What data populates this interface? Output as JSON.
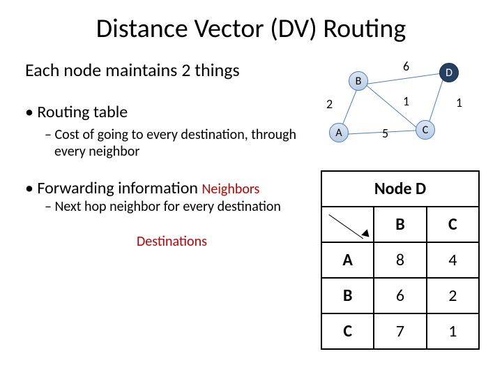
{
  "title": "Distance Vector (DV) Routing",
  "intro": "Each node maintains 2 things",
  "bullets": {
    "b1": "Routing table",
    "s1": "Cost of going to every destination, through every neighbor",
    "b2": "Forwarding information",
    "s2": "Next hop neighbor for every destination"
  },
  "labels": {
    "neighbors": "Neighbors",
    "destinations": "Destinations"
  },
  "graph": {
    "nodes": {
      "A": "A",
      "B": "B",
      "C": "C",
      "D": "D"
    },
    "weights": {
      "ab": "2",
      "bd": "6",
      "bc": "1",
      "cd": "1",
      "ac": "5"
    }
  },
  "table": {
    "title": "Node D",
    "cols": [
      "B",
      "C"
    ],
    "rows": [
      {
        "h": "A",
        "v": [
          "8",
          "4"
        ]
      },
      {
        "h": "B",
        "v": [
          "6",
          "2"
        ]
      },
      {
        "h": "C",
        "v": [
          "7",
          "1"
        ]
      }
    ]
  }
}
